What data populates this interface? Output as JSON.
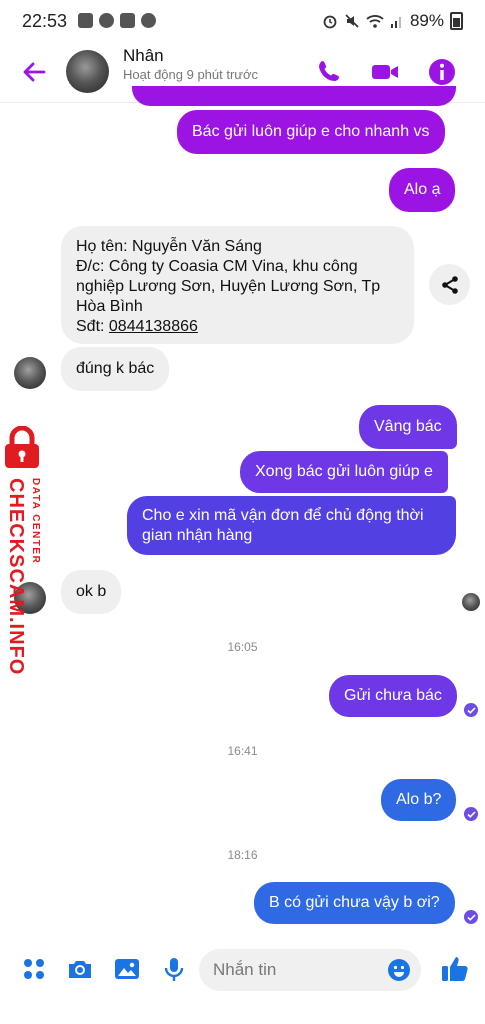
{
  "status_bar": {
    "time": "22:53",
    "battery": "89%"
  },
  "header": {
    "name": "Nhân",
    "status": "Hoạt động 9 phút trước"
  },
  "messages": {
    "m1": "Bác gửi luôn giúp e cho nhanh vs",
    "m2": "Alo ạ",
    "m3": {
      "line1": "Họ tên: Nguyễn Văn Sáng",
      "line2": "Đ/c: Công ty Coasia CM Vina, khu công",
      "line3": "nghiệp Lương Sơn, Huyện Lương Sơn, Tp",
      "line4": "Hòa Bình",
      "phone_label": "Sđt: ",
      "phone": "0844138866"
    },
    "m4": "đúng k bác",
    "m5": "Vâng bác",
    "m6": "Xong bác gửi luôn giúp e",
    "m7_line1": "Cho e xin mã vận đơn để chủ động thời",
    "m7_line2": "gian nhận hàng",
    "m8": "ok b",
    "ts1": "16:05",
    "m9": "Gửi chưa bác",
    "ts2": "16:41",
    "m10": "Alo b?",
    "ts3": "18:16",
    "m11": "B có gửi chưa vậy b ơi?"
  },
  "watermark": {
    "brand": "CHECKSCAM.INFO",
    "sub": "DATA CENTER"
  },
  "composer": {
    "placeholder": "Nhắn tin"
  },
  "colors": {
    "accent": "#9b14e4",
    "icon_blue": "#1b74e4"
  }
}
